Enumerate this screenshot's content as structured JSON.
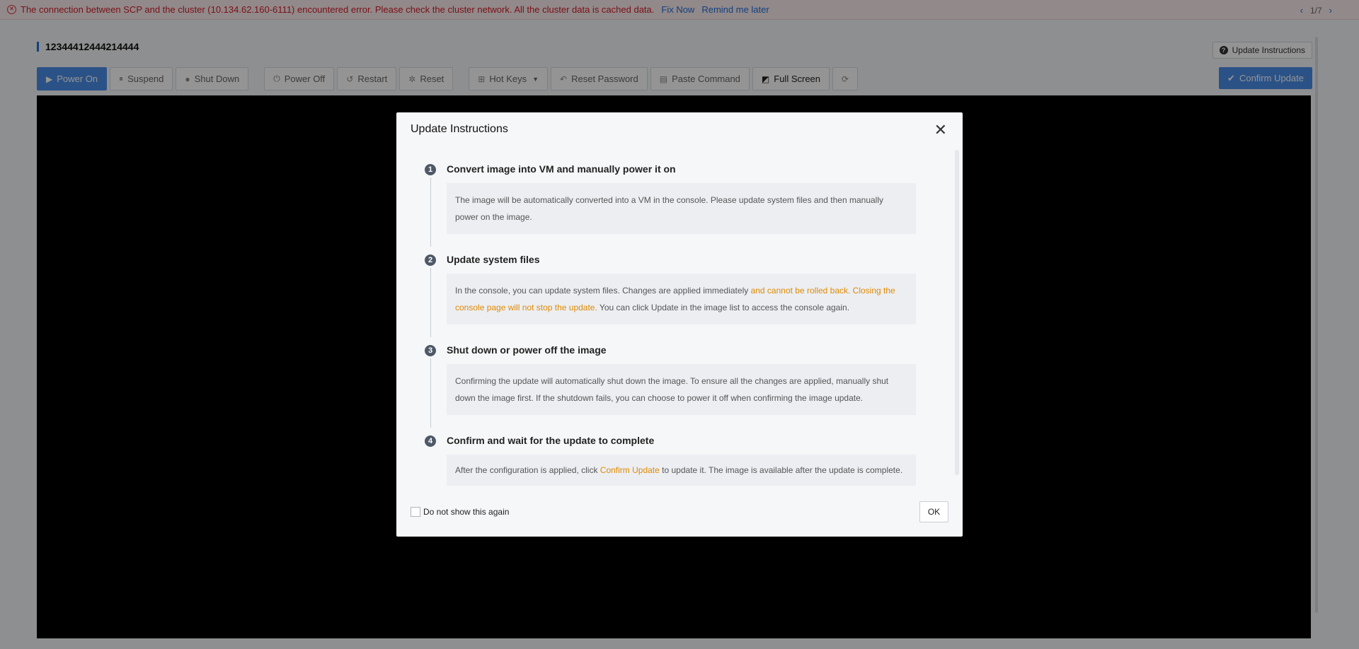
{
  "alert": {
    "icon": "error-circle-icon",
    "message": "The connection between SCP and the cluster (10.134.62.160-6111) encountered error. Please check the cluster network. All the cluster data is cached data.",
    "fix_now": "Fix Now",
    "remind_later": "Remind me later",
    "pager": "1/7",
    "prev_icon": "chevron-left-icon",
    "next_icon": "chevron-right-icon"
  },
  "page": {
    "title": "12344412444214444",
    "update_instructions_btn": "Update Instructions"
  },
  "toolbar": {
    "power_on": "Power On",
    "suspend": "Suspend",
    "shut_down": "Shut Down",
    "power_off": "Power Off",
    "restart": "Restart",
    "reset": "Reset",
    "hot_keys": "Hot Keys",
    "reset_password": "Reset Password",
    "paste_command": "Paste Command",
    "full_screen": "Full Screen",
    "confirm_update": "Confirm Update"
  },
  "modal": {
    "title": "Update Instructions",
    "steps": [
      {
        "num": "1",
        "title": "Convert image into VM and manually power it on",
        "text": "The image will be automatically converted into a VM in the console. Please update system files and then manually power on the image."
      },
      {
        "num": "2",
        "title": "Update system files",
        "text_a": "In the console, you can update system files. Changes are applied immediately ",
        "text_b": "and cannot be rolled back. Closing the console page will not stop the update.",
        "text_c": " You can click Update in the image list to access the console again."
      },
      {
        "num": "3",
        "title": "Shut down or power off the image",
        "text": "Confirming the update will automatically shut down the image. To ensure all the changes are applied, manually shut down the image first. If the shutdown fails, you can choose to power it off when confirming the image update."
      },
      {
        "num": "4",
        "title": "Confirm and wait for the update to complete",
        "text_a": "After the configuration is applied, click ",
        "text_b": "Confirm Update",
        "text_c": " to update it. The image is available after the update is complete."
      }
    ],
    "do_not_show": "Do not show this again",
    "ok": "OK"
  },
  "colors": {
    "accent": "#1f6fd8",
    "primary_button": "#4b8de8",
    "error": "#d0202a",
    "highlight": "#e08a00"
  }
}
